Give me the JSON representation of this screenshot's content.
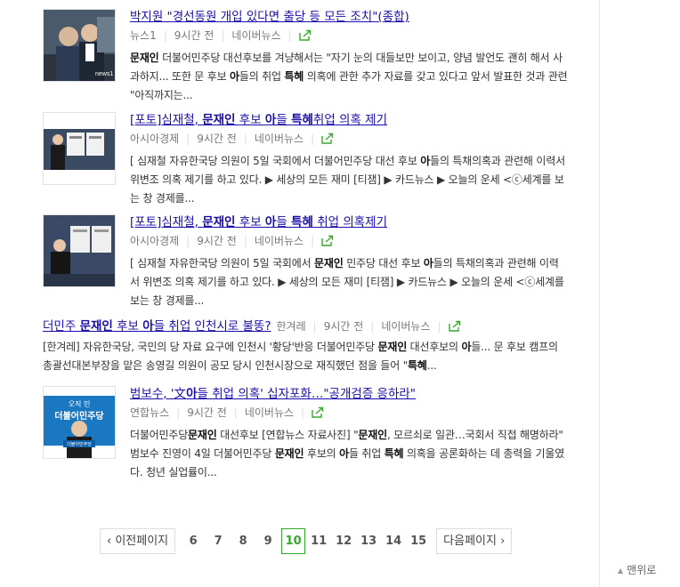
{
  "articles": [
    {
      "title": "박지원 \"경선동원 개입 있다면 출당 등 모든 조치\"(종합)",
      "source": "뉴스1",
      "time": "9시간 전",
      "naver": "네이버뉴스",
      "desc_html": "<b>문재인</b> 더불어민주당 대선후보를 겨냥해서는 \"자기 눈의 대들보만 보이고, 양념 발언도 괜히 해서 사과하지... 또한 문 후보 <b>아</b>들의 취업 <b>특혜</b> 의혹에 관한 추가 자료를 갖고 있다고 앞서 발표한 것과 관련 \"아직까지는..."
    },
    {
      "title_html": "[포토]심재철, <b>문재인</b> 후보 <b>아</b>들 <b>특혜</b>취업 의혹 제기",
      "source": "아시아경제",
      "time": "9시간 전",
      "naver": "네이버뉴스",
      "desc_html": "[ 심재철 자유한국당 의원이 5일 국회에서 더불어민주당 대선 후보 <b>아</b>들의 특채의혹과 관련해 이력서 위변조 의혹 제기를 하고 있다. ▶ 세상의 모든 재미 [티잼] ▶ 카드뉴스 ▶ 오늘의 운세 &lt;ⓒ세계를 보는 창 경제를..."
    },
    {
      "title_html": "[포토]심재철, <b>문재인</b> 후보 <b>아</b>들 <b>특혜</b> 취업 의혹제기",
      "source": "아시아경제",
      "time": "9시간 전",
      "naver": "네이버뉴스",
      "desc_html": "[ 심재철 자유한국당 의원이 5일 국회에서 <b>문재인</b> 민주당 대선 후보 <b>아</b>들의 특채의혹과 관련해 이력서 위변조 의혹 제기를 하고 있다. ▶ 세상의 모든 재미 [티잼] ▶ 카드뉴스 ▶ 오늘의 운세 &lt;ⓒ세계를 보는 창 경제를..."
    },
    {
      "title_html": "더민주 <b>문재인</b> 후보 <b>아</b>들 취업 인천시로 불똥?",
      "source": "한겨레",
      "time": "9시간 전",
      "naver": "네이버뉴스",
      "desc_html": "[한겨레] 자유한국당, 국민의 당 자료 요구에 인천시 '황당'반응 더불어민주당 <b>문재인</b> 대선후보의 <b>아</b>들... 문 후보 캠프의 총괄선대본부장을 맡은 송영길 의원이 공모 당시 인천시장으로 재직했던 점을 들어 \"<b>특혜</b>..."
    },
    {
      "title_html": "범보수, '文<b>아</b>들 취업 의혹' 십자포화…\"공개검증 응하라\"",
      "source": "연합뉴스",
      "time": "9시간 전",
      "naver": "네이버뉴스",
      "desc_html": "더불어민주당<b>문재인</b> 대선후보 [연합뉴스 자료사진] \"<b>문재인</b>, 모르쇠로 일관…국회서 직접 해명하라\" 범보수 진영이 4일 더불어민주당 <b>문재인</b> 후보의 <b>아</b>들 취업 <b>특혜</b> 의혹을 공론화하는 데 총력을 기울였다. 청년 실업률이..."
    }
  ],
  "thumb5_text": {
    "line1": "오직 민",
    "line2": "더불어민주당",
    "line3": "더불어민주당"
  },
  "thumb1_watermark": "news1",
  "pagination": {
    "prev": "이전페이지",
    "next": "다음페이지",
    "pages": [
      "6",
      "7",
      "8",
      "9",
      "10",
      "11",
      "12",
      "13",
      "14",
      "15"
    ],
    "current": "10"
  },
  "side": {
    "top_link": "맨위로"
  },
  "colors": {
    "link": "#1a0dab",
    "accent_green": "#37a82e"
  }
}
